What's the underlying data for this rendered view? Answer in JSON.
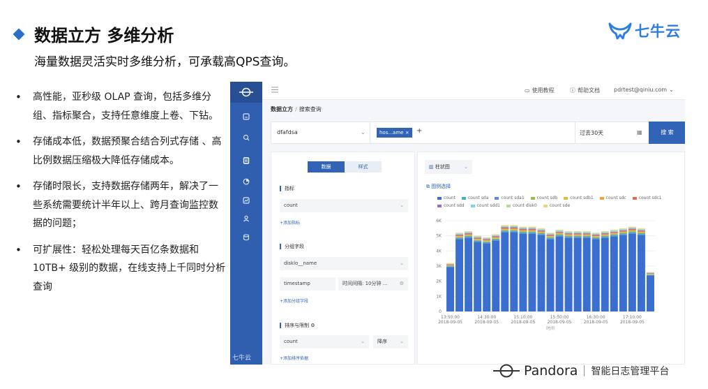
{
  "slide": {
    "title": "数据立方 多维分析",
    "subtitle": "海量数据灵活实时多维分析，可承载高QPS查询。",
    "bullets": [
      "高性能，亚秒级 OLAP 查询，包括多维分组、指标聚合，支持任意维度上卷、下钻。",
      "存储成本低，数据预聚合结合列式存储 、高比例数据压缩极大降低存储成本。",
      "存储时限长，支持数据存储两年，解决了一些系统需要统计半年以上、跨月查询监控数据的问题；",
      "可扩展性：轻松处理每天百亿条数据和10TB+ 级别的数据，在线支持上千同时分析查询"
    ],
    "logo_text": "七牛云",
    "footer_brand": "Pandora",
    "footer_subtitle": "智能日志管理平台"
  },
  "app": {
    "side_footer": "七牛云",
    "topbar": {
      "tutorial": "使用教程",
      "help": "帮助文档",
      "user": "pdrtest@qiniu.com"
    },
    "breadcrumb": {
      "root": "数据立方",
      "sep": "/",
      "current": "搜索查询"
    },
    "query": {
      "repo": "dfafdsa",
      "tag": "hos...ame",
      "time_range": "过去30天",
      "search_label": "搜 索"
    },
    "config": {
      "tab_data": "数据",
      "tab_style": "样式",
      "metrics_label": "指标",
      "metric_value": "count",
      "add_metric": "+添加指标",
      "group_label": "分组字段",
      "group_value1": "disklo__name",
      "group_value2": "timestamp",
      "interval_label": "时间间隔: 10分钟 ...",
      "add_group": "+添加分组字段",
      "sort_label": "排序与限制",
      "sort_field": "count",
      "sort_order": "降序",
      "add_sort": "+添加排序依据"
    },
    "chart_type_label": "柱状图",
    "legend_select_label": "图例选择",
    "colors": {
      "primary": "#3164b6",
      "sidebar": "#2f5fae"
    }
  },
  "chart_data": {
    "type": "bar",
    "stacked": true,
    "title": "",
    "xlabel": "时间",
    "ylabel": "",
    "ylim": [
      0,
      6000
    ],
    "y_ticks": [
      "0",
      "1K",
      "2K",
      "3K",
      "4K",
      "5K",
      "6K"
    ],
    "x_ticks": [
      {
        "time": "13:50:00",
        "date": "2018-09-05"
      },
      {
        "time": "14:30:00",
        "date": "2018-09-05"
      },
      {
        "time": "15:10:00",
        "date": "2018-09-05"
      },
      {
        "time": "15:50:00",
        "date": "2018-09-05"
      },
      {
        "time": "16:30:00",
        "date": "2018-09-05"
      },
      {
        "time": "17:10:00",
        "date": "2018-09-05"
      }
    ],
    "series_names": [
      "count",
      "count sda",
      "count sda1",
      "count sdb",
      "count sdb1",
      "count sdc",
      "count sdc1",
      "count sdd",
      "count sdd1",
      "count disk0",
      "count sde"
    ],
    "series_colors": [
      "#3a6fd0",
      "#3fb5c4",
      "#5b8fd9",
      "#8cc152",
      "#d8c23c",
      "#f0a23b",
      "#e56a4d",
      "#9b6ec6",
      "#7fd0e8",
      "#b4d99a",
      "#f4d27a"
    ],
    "totals": [
      3200,
      5200,
      5300,
      5000,
      4900,
      5100,
      5700,
      5700,
      5600,
      5600,
      5500,
      5200,
      5400,
      5300,
      5300,
      5300,
      5200,
      5300,
      5400,
      5500,
      5600,
      5500,
      2600
    ],
    "top_share": 0.08
  }
}
